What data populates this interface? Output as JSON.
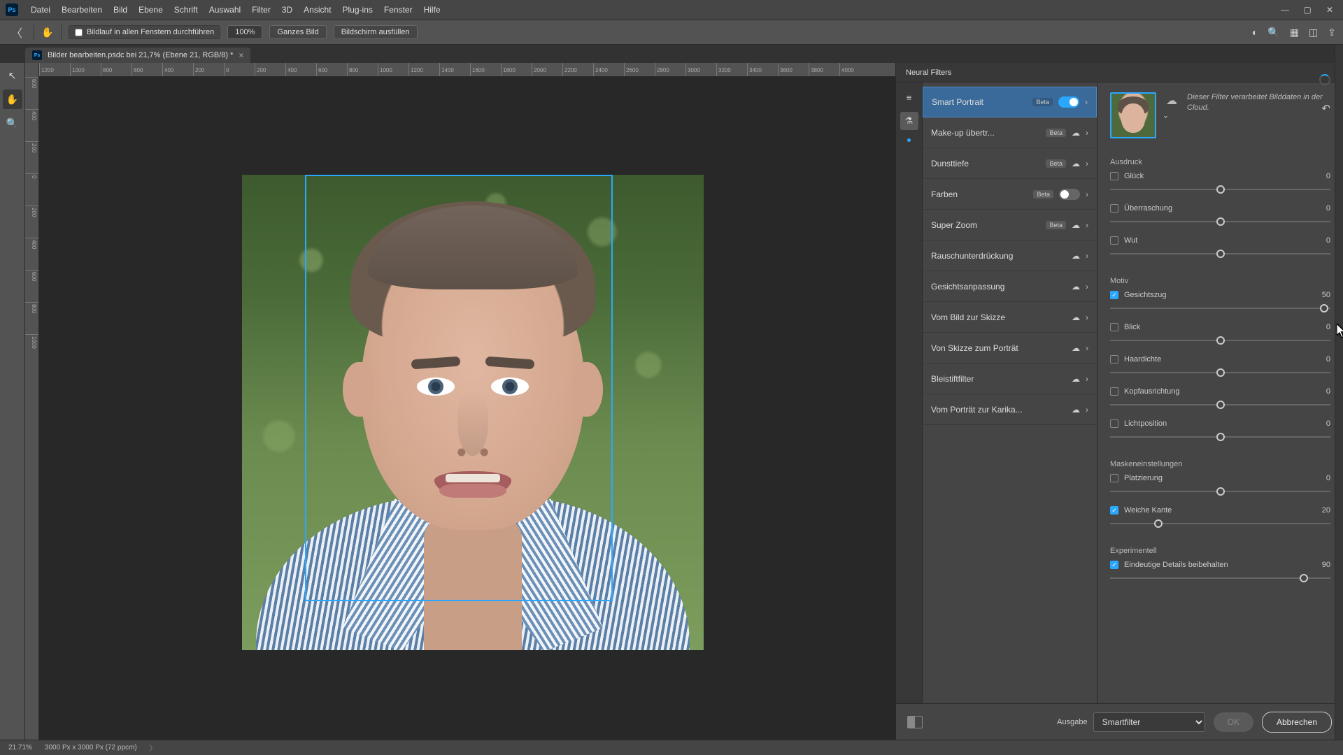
{
  "menu": [
    "Datei",
    "Bearbeiten",
    "Bild",
    "Ebene",
    "Schrift",
    "Auswahl",
    "Filter",
    "3D",
    "Ansicht",
    "Plug-ins",
    "Fenster",
    "Hilfe"
  ],
  "optbar": {
    "scroll_all": "Bildlauf in allen Fenstern durchführen",
    "zoom": "100%",
    "fit": "Ganzes Bild",
    "fill": "Bildschirm ausfüllen"
  },
  "doc": {
    "title": "Bilder bearbeiten.psdc bei 21,7% (Ebene 21, RGB/8) *"
  },
  "ruler_h": [
    "1200",
    "1000",
    "800",
    "600",
    "400",
    "200",
    "0",
    "200",
    "400",
    "600",
    "800",
    "1000",
    "1200",
    "1400",
    "1600",
    "1800",
    "2000",
    "2200",
    "2400",
    "2600",
    "2800",
    "3000",
    "3200",
    "3400",
    "3600",
    "3800",
    "4000"
  ],
  "ruler_v": [
    "600",
    "400",
    "200",
    "0",
    "200",
    "400",
    "600",
    "800",
    "1000"
  ],
  "nf": {
    "title": "Neural Filters"
  },
  "filters": [
    {
      "name": "Smart Portrait",
      "beta": true,
      "right": "toggle-on",
      "selected": true
    },
    {
      "name": "Make-up übertr...",
      "beta": true,
      "right": "cloud"
    },
    {
      "name": "Dunsttiefe",
      "beta": true,
      "right": "cloud"
    },
    {
      "name": "Farben",
      "beta": true,
      "right": "toggle-off"
    },
    {
      "name": "Super Zoom",
      "beta": true,
      "right": "cloud"
    },
    {
      "name": "Rauschunterdrückung",
      "beta": false,
      "right": "cloud"
    },
    {
      "name": "Gesichtsanpassung",
      "beta": false,
      "right": "cloud"
    },
    {
      "name": "Vom Bild zur Skizze",
      "beta": false,
      "right": "cloud"
    },
    {
      "name": "Von Skizze zum Porträt",
      "beta": false,
      "right": "cloud"
    },
    {
      "name": "Bleistiftfilter",
      "beta": false,
      "right": "cloud"
    },
    {
      "name": "Vom Porträt zur Karika...",
      "beta": false,
      "right": "cloud"
    }
  ],
  "cloud_text": "Dieser Filter verarbeitet Bilddaten in der Cloud.",
  "sections": {
    "ausdruck": "Ausdruck",
    "motiv": "Motiv",
    "maske": "Maskeneinstellungen",
    "exp": "Experimentell"
  },
  "sliders": {
    "glueck": {
      "label": "Glück",
      "val": "0",
      "pct": 50,
      "chk": false
    },
    "ueber": {
      "label": "Überraschung",
      "val": "0",
      "pct": 50,
      "chk": false
    },
    "wut": {
      "label": "Wut",
      "val": "0",
      "pct": 50,
      "chk": false
    },
    "gesicht": {
      "label": "Gesichtszug",
      "val": "50",
      "pct": 97,
      "chk": true
    },
    "blick": {
      "label": "Blick",
      "val": "0",
      "pct": 50,
      "chk": false
    },
    "haar": {
      "label": "Haardichte",
      "val": "0",
      "pct": 50,
      "chk": false
    },
    "kopf": {
      "label": "Kopfausrichtung",
      "val": "0",
      "pct": 50,
      "chk": false
    },
    "licht": {
      "label": "Lichtposition",
      "val": "0",
      "pct": 50,
      "chk": false
    },
    "platz": {
      "label": "Platzierung",
      "val": "0",
      "pct": 50,
      "chk": false
    },
    "weich": {
      "label": "Weiche Kante",
      "val": "20",
      "pct": 22,
      "chk": true
    },
    "detail": {
      "label": "Eindeutige Details beibehalten",
      "val": "90",
      "pct": 88,
      "chk": true
    }
  },
  "footer": {
    "ausgabe": "Ausgabe",
    "select": "Smartfilter",
    "ok": "OK",
    "cancel": "Abbrechen"
  },
  "status": {
    "zoom": "21.71%",
    "dim": "3000 Px x 3000 Px (72 ppcm)"
  }
}
